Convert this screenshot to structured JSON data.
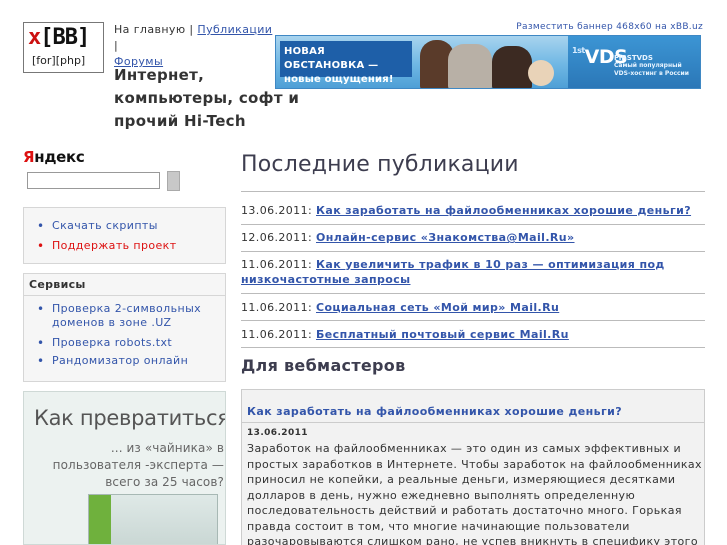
{
  "logo": {
    "top": "x[BB]",
    "top_x": "x",
    "top_rest": "[BB]",
    "bottom": "[for][php]"
  },
  "topnav": {
    "home": "На главную",
    "sep1": " | ",
    "publications": "Публикации",
    "sep2": " |",
    "forums": "Форумы"
  },
  "tagline": "Интернет, компьютеры, софт и прочий Hi-Tech",
  "banner": {
    "link": "Разместить баннер 468x60 на xBB.uz",
    "text_line1": "НОВАЯ ОБСТАНОВКА —",
    "text_line2": "новые ощущения!",
    "logo_first": "1st",
    "logo_vds": "VDS",
    "sub_brand": "FIRSTVDS",
    "sub_line": "Самый популярный VDS-хостинг в России"
  },
  "search": {
    "logo_y": "Я",
    "logo_rest": "ндекс",
    "placeholder": ""
  },
  "links": [
    {
      "label": "Скачать скрипты",
      "style": "normal"
    },
    {
      "label": "Поддержать проект",
      "style": "red"
    }
  ],
  "services": {
    "title": "Сервисы",
    "items": [
      "Проверка 2-символьных доменов в зоне .UZ",
      "Проверка robots.txt",
      "Рандомизатор онлайн"
    ]
  },
  "ad": {
    "title": "Как превратиться...",
    "subtitle": "... из «чайника» в пользователя -эксперта — всего за 25 часов?"
  },
  "latest": {
    "heading": "Последние публикации",
    "items": [
      {
        "date": "13.06.2011:",
        "title": "Как заработать на файлообменниках хорошие деньги?"
      },
      {
        "date": "12.06.2011:",
        "title": "Онлайн-сервис «Знакомства@Mail.Ru»"
      },
      {
        "date": "11.06.2011:",
        "title": "Как увеличить трафик в 10 раз — оптимизация под низкочастотные запросы"
      },
      {
        "date": "11.06.2011:",
        "title": "Социальная сеть «Мой мир» Mail.Ru"
      },
      {
        "date": "11.06.2011:",
        "title": "Бесплатный почтовый сервис Mail.Ru"
      }
    ]
  },
  "webmasters": {
    "heading": "Для вебмастеров",
    "article": {
      "title": "Как заработать на файлообменниках хорошие деньги?",
      "date": "13.06.2011",
      "body": "Заработок на файлообменниках — это один из самых эффективных и простых заработков в Интернете. Чтобы заработок на файлообменниках приносил не копейки, а реальные деньги, измеряющиеся десятками долларов в день, нужно ежедневно выполнять определенную последовательность действий и работать достаточно много. Горькая правда состоит в том, что многие начинающие пользователи разочаровываются слишком рано, не успев вникнуть в специфику этого"
    }
  },
  "colors": {
    "link": "#3355aa",
    "accent_red": "#dd1111",
    "heading": "#3d3d4f",
    "box_bg": "#f6f6f6"
  }
}
